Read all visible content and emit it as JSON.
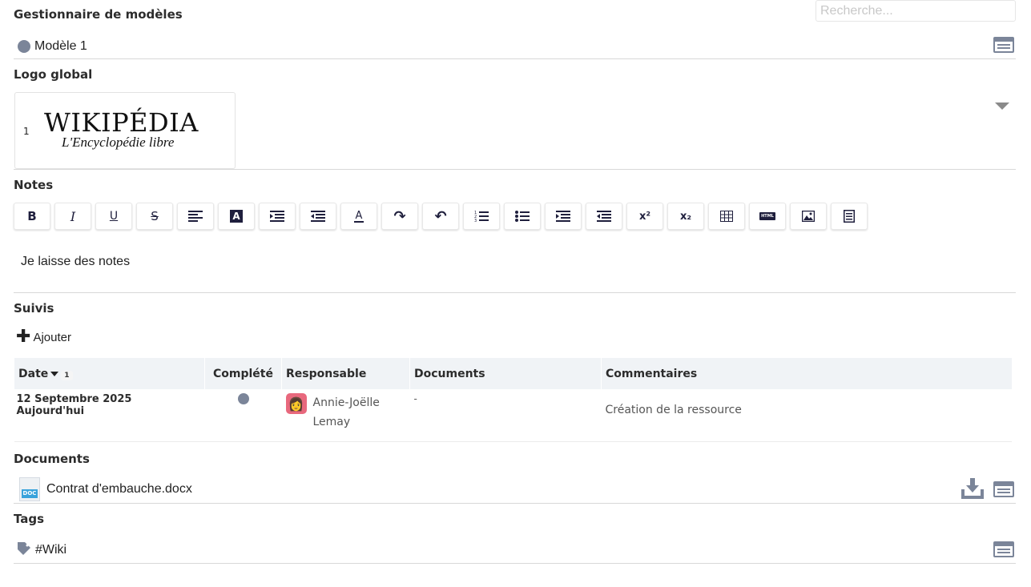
{
  "search": {
    "placeholder": "Recherche..."
  },
  "template_manager": {
    "title": "Gestionnaire de modèles",
    "value": "Modèle 1"
  },
  "global_logo": {
    "title": "Logo global",
    "item_index": "1",
    "logo_main": "WIKIPÉDIA",
    "logo_sub": "L'Encyclopédie libre"
  },
  "notes": {
    "title": "Notes",
    "toolbar": [
      {
        "name": "bold",
        "glyph": "B"
      },
      {
        "name": "italic",
        "glyph": "I"
      },
      {
        "name": "underline",
        "glyph": "U"
      },
      {
        "name": "strikethrough",
        "glyph": "S"
      },
      {
        "name": "align-left",
        "glyph": ""
      },
      {
        "name": "highlight",
        "glyph": "A"
      },
      {
        "name": "indent",
        "glyph": ""
      },
      {
        "name": "outdent",
        "glyph": ""
      },
      {
        "name": "text-color",
        "glyph": "A"
      },
      {
        "name": "redo",
        "glyph": "↷"
      },
      {
        "name": "undo",
        "glyph": "↶"
      },
      {
        "name": "ordered-list",
        "glyph": ""
      },
      {
        "name": "unordered-list",
        "glyph": ""
      },
      {
        "name": "indent-2",
        "glyph": ""
      },
      {
        "name": "outdent-2",
        "glyph": ""
      },
      {
        "name": "superscript",
        "glyph": "x²"
      },
      {
        "name": "subscript",
        "glyph": "x₂"
      },
      {
        "name": "table",
        "glyph": ""
      },
      {
        "name": "html",
        "glyph": "HTML"
      },
      {
        "name": "image",
        "glyph": ""
      },
      {
        "name": "source",
        "glyph": ""
      }
    ],
    "content": "Je laisse des notes"
  },
  "followups": {
    "title": "Suivis",
    "add_label": "Ajouter",
    "columns": {
      "date": "Date",
      "sort_index": "1",
      "completed": "Complété",
      "responsible": "Responsable",
      "documents": "Documents",
      "comments": "Commentaires"
    },
    "rows": [
      {
        "date": "12 Septembre 2025 Aujourd'hui",
        "responsible": "Annie-Joëlle Lemay",
        "documents": "-",
        "comment": "Création de la ressource"
      }
    ]
  },
  "documents": {
    "title": "Documents",
    "file_name": "Contrat d'embauche.docx",
    "file_badge": "DOC"
  },
  "tags": {
    "title": "Tags",
    "value": "#Wiki"
  },
  "colors": {
    "icon_gray": "#7b8599",
    "header_bg": "#f0f3f6",
    "doc_blue": "#3aa3db",
    "avatar_pink": "#e8687d"
  }
}
